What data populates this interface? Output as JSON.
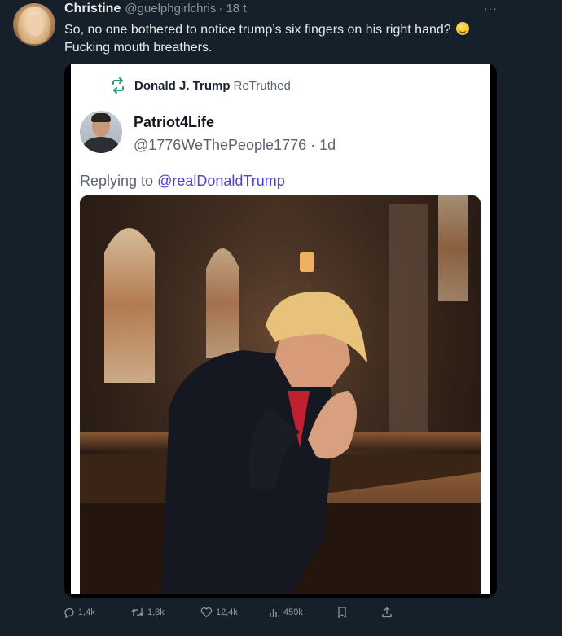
{
  "tweet": {
    "author_name": "Christine",
    "author_handle": "@guelphgirlchris",
    "time": "· 18 t",
    "more": "···",
    "text": "So, no one bothered to notice trump’s six fingers on his right hand?",
    "text_line2": "Fucking mouth breathers.",
    "emoji_icon": "rolling-on-floor-laughing-emoji"
  },
  "embedded": {
    "retruth_name": "Donald J. Trump",
    "retruth_label": "ReTruthed",
    "poster_name": "Patriot4Life",
    "poster_handle": "@1776WeThePeople1776 · 1d",
    "reply_prefix": "Replying to ",
    "reply_mention": "@realDonaldTrump",
    "image_description_icon": "church-prayer-photo"
  },
  "actions": {
    "replies": "1,4k",
    "retweets": "1,8k",
    "likes": "12,4k",
    "views": "459k"
  },
  "colors": {
    "background": "#15202b",
    "card": "#ffffff",
    "mention": "#4b45c9",
    "retruth_icon": "#2a9d6a"
  }
}
